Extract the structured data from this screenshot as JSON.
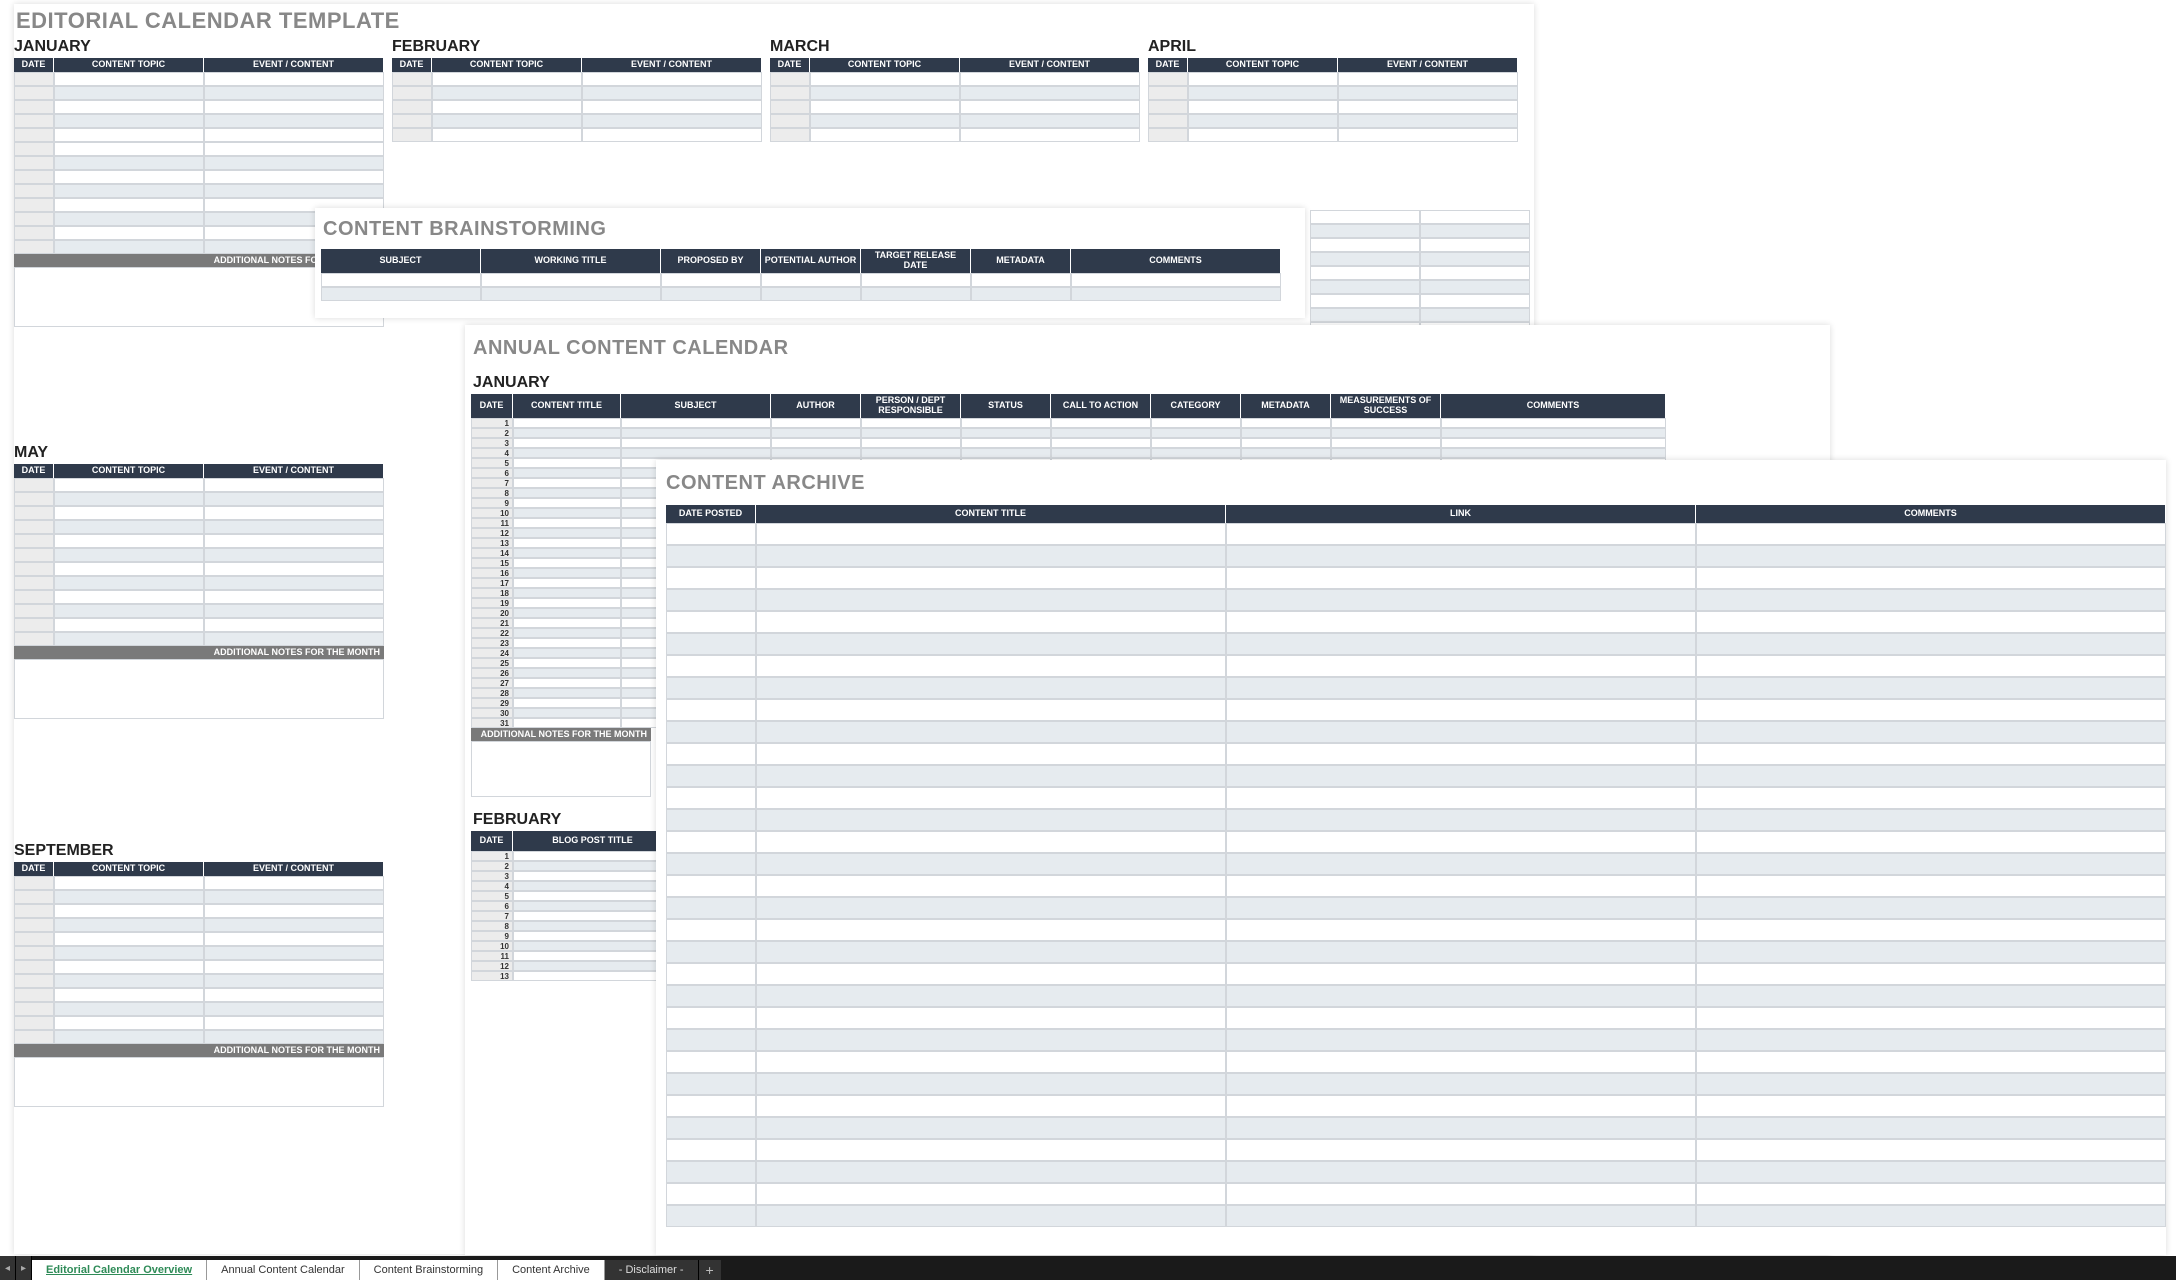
{
  "editorial": {
    "title": "EDITORIAL CALENDAR TEMPLATE",
    "columns": [
      "DATE",
      "CONTENT TOPIC",
      "EVENT / CONTENT"
    ],
    "months_row1": [
      "JANUARY",
      "FEBRUARY",
      "MARCH",
      "APRIL"
    ],
    "months_row2": [
      "MAY"
    ],
    "months_row3": [
      "SEPTEMBER"
    ],
    "notes_label": "ADDITIONAL NOTES FOR THE MONTH"
  },
  "brainstorm": {
    "title": "CONTENT BRAINSTORMING",
    "columns": [
      "SUBJECT",
      "WORKING TITLE",
      "PROPOSED BY",
      "POTENTIAL AUTHOR",
      "TARGET RELEASE DATE",
      "METADATA",
      "COMMENTS"
    ]
  },
  "annual": {
    "title": "ANNUAL CONTENT CALENDAR",
    "month1": "JANUARY",
    "month2": "FEBRUARY",
    "columns": [
      "DATE",
      "CONTENT TITLE",
      "SUBJECT",
      "AUTHOR",
      "PERSON / DEPT RESPONSIBLE",
      "STATUS",
      "CALL TO ACTION",
      "CATEGORY",
      "METADATA",
      "MEASUREMENTS OF SUCCESS",
      "COMMENTS"
    ],
    "columns2": [
      "DATE",
      "BLOG POST TITLE"
    ],
    "days31": [
      "1",
      "2",
      "3",
      "4",
      "5",
      "6",
      "7",
      "8",
      "9",
      "10",
      "11",
      "12",
      "13",
      "14",
      "15",
      "16",
      "17",
      "18",
      "19",
      "20",
      "21",
      "22",
      "23",
      "24",
      "25",
      "26",
      "27",
      "28",
      "29",
      "30",
      "31"
    ],
    "days_partial": [
      "1",
      "2",
      "3",
      "4",
      "5",
      "6",
      "7",
      "8",
      "9",
      "10",
      "11",
      "12",
      "13"
    ],
    "notes_label": "ADDITIONAL NOTES FOR THE MONTH"
  },
  "archive": {
    "title": "CONTENT ARCHIVE",
    "columns": [
      "DATE POSTED",
      "CONTENT TITLE",
      "LINK",
      "COMMENTS"
    ]
  },
  "tabs": {
    "t1": "Editorial Calendar Overview",
    "t2": "Annual Content Calendar",
    "t3": "Content Brainstorming",
    "t4": "Content Archive",
    "t5": "- Disclaimer -"
  }
}
